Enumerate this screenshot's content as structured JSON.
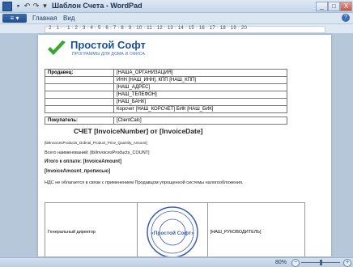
{
  "window": {
    "title": "Шаблон Счета - WordPad",
    "controls": {
      "minimize": "_",
      "maximize": "□",
      "close": "X"
    }
  },
  "quick_access": [
    "save-icon",
    "undo-icon",
    "redo-icon",
    "dropdown-icon"
  ],
  "ribbon": {
    "app_menu_icon": "menu-icon",
    "tabs": [
      "Главная",
      "Вид"
    ],
    "help": "?"
  },
  "ruler": {
    "ticks": "· 2 · 1 · · 1 · 2 · 3 · 4 · 5 · 6 · 7 · 8 · 9 · 10 · 11 · 12 · 13 · 14 · 15 · 16 · 17 · 18 · 19 · 20"
  },
  "document": {
    "brand": {
      "name": "Простой Софт",
      "tagline": "ПРОГРАММЫ ДЛЯ ДОМА И ОФИСА"
    },
    "parties": {
      "seller_label": "Продавец:",
      "seller_lines": [
        "[НАША_ОРГАНИЗАЦИЯ]",
        "ИНН [НАШ_ИНН], КПП [НАШ_КПП]",
        "[НАШ_АДРЕС]",
        "[НАШ_ТЕЛЕФОН]",
        "[НАШ_БАНК]",
        "Корсчет [НАШ_КОРСЧЕТ] БИК [НАШ_БИК]"
      ],
      "buyer_label": "Покупатель:",
      "buyer_value": "[ClientCalc]"
    },
    "invoice_title": "СЧЕТ [InvoiceNumber] от [InvoiceDate]",
    "products_line": "[tblInvoicesProducts_Ordinal_Product_Price_Quantity_Amount]",
    "count_line": "Всего наименований: [tblInvoicesProducts_COUNT]",
    "total_line": "Итого к оплате: [InvoiceAmount]",
    "amount_words_line": "[InvoiceAmount_прописью]",
    "vat_note": "НДС не облагается в связи с применением Продавцом упрощенной системы налогообложения.",
    "signature": {
      "position": "Генеральный директор",
      "stamp_text": "«Простой Софт»",
      "manager": "[НАШ_РУКОВОДИТЕЛЬ]"
    }
  },
  "statusbar": {
    "zoom": "80%",
    "zoom_out": "−",
    "zoom_in": "+"
  },
  "colors": {
    "brand_blue": "#1a4f9c",
    "logo_green": "#3aa634",
    "stamp_blue": "#3b5fb0"
  }
}
